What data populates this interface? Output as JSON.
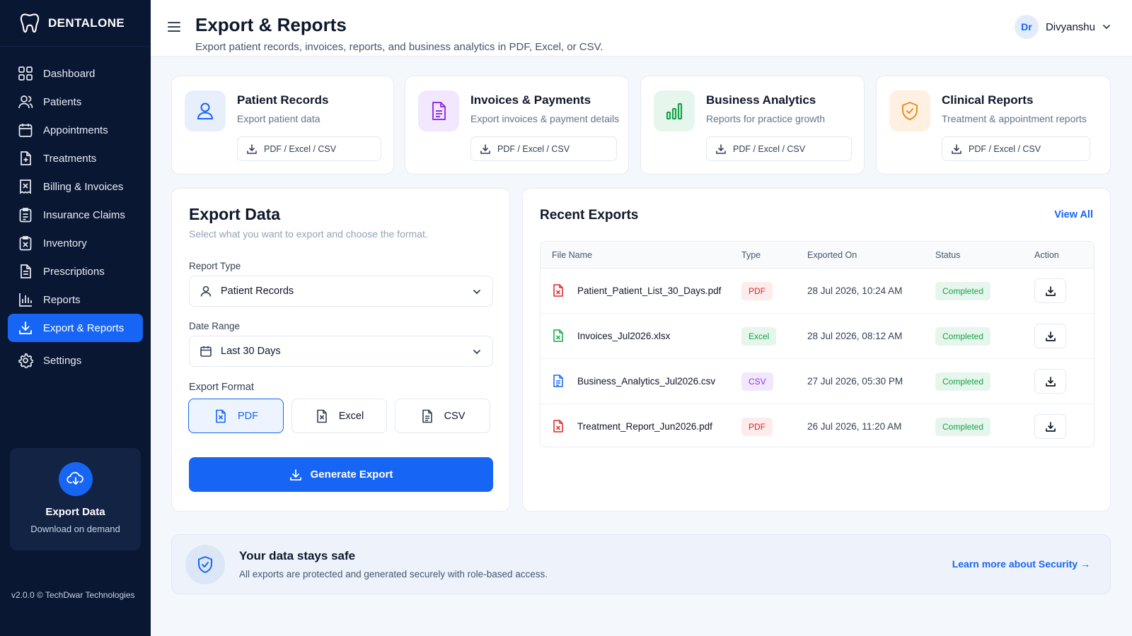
{
  "brand": {
    "name": "DENTALONE"
  },
  "sidebar": {
    "items": [
      {
        "label": "Dashboard",
        "icon": "grid-icon"
      },
      {
        "label": "Patients",
        "icon": "users-icon"
      },
      {
        "label": "Appointments",
        "icon": "calendar-icon"
      },
      {
        "label": "Treatments",
        "icon": "file-plus-icon"
      },
      {
        "label": "Billing & Invoices",
        "icon": "invoice-icon"
      },
      {
        "label": "Insurance Claims",
        "icon": "clipboard-icon"
      },
      {
        "label": "Inventory",
        "icon": "box-icon"
      },
      {
        "label": "Prescriptions",
        "icon": "prescription-icon"
      },
      {
        "label": "Reports",
        "icon": "bar-chart-icon"
      },
      {
        "label": "Export & Reports",
        "icon": "download-icon",
        "active": true
      },
      {
        "label": "Settings",
        "icon": "gear-icon"
      }
    ],
    "promo": {
      "title": "Export Data",
      "subtitle": "Download on demand"
    },
    "version": "v2.0.0 © TechDwar Technologies"
  },
  "header": {
    "title": "Export & Reports",
    "subtitle": "Export patient records, invoices, reports, and business analytics in PDF, Excel, or CSV.",
    "user": {
      "initials": "Dr",
      "name": "Divyanshu"
    }
  },
  "categories": [
    {
      "title": "Patient Records",
      "desc": "Export patient data",
      "button": "PDF / Excel / CSV",
      "icon": "user-icon",
      "color": "#1765f5",
      "bg": "#e7effd"
    },
    {
      "title": "Invoices & Payments",
      "desc": "Export invoices & payment details",
      "button": "PDF / Excel / CSV",
      "icon": "document-icon",
      "color": "#9333ea",
      "bg": "#f1e8fd"
    },
    {
      "title": "Business Analytics",
      "desc": "Reports for practice growth",
      "button": "PDF / Excel / CSV",
      "icon": "bar-chart-icon",
      "color": "#16a34a",
      "bg": "#e6f6ec"
    },
    {
      "title": "Clinical Reports",
      "desc": "Treatment & appointment reports",
      "button": "PDF / Excel / CSV",
      "icon": "shield-icon",
      "color": "#f08c1a",
      "bg": "#fef1e2"
    }
  ],
  "export": {
    "title": "Export Data",
    "subtitle": "Select what you want to export and choose the format.",
    "report_type_label": "Report Type",
    "report_type_value": "Patient Records",
    "date_range_label": "Date Range",
    "date_range_value": "Last 30 Days",
    "format_label": "Export Format",
    "formats": [
      {
        "label": "PDF",
        "selected": true
      },
      {
        "label": "Excel",
        "selected": false
      },
      {
        "label": "CSV",
        "selected": false
      }
    ],
    "generate_label": "Generate Export"
  },
  "recent": {
    "title": "Recent Exports",
    "view_all": "View All",
    "columns": [
      "File Name",
      "Type",
      "Exported On",
      "Status",
      "Action"
    ],
    "rows": [
      {
        "file": "Patient_Patient_List_30_Days.pdf",
        "type": "PDF",
        "date": "28 Jul 2026, 10:24 AM",
        "status": "Completed"
      },
      {
        "file": "Invoices_Jul2026.xlsx",
        "type": "Excel",
        "date": "28 Jul 2026, 08:12 AM",
        "status": "Completed"
      },
      {
        "file": "Business_Analytics_Jul2026.csv",
        "type": "CSV",
        "date": "27 Jul 2026, 05:30 PM",
        "status": "Completed"
      },
      {
        "file": "Treatment_Report_Jun2026.pdf",
        "type": "PDF",
        "date": "26 Jul 2026, 11:20 AM",
        "status": "Completed"
      }
    ]
  },
  "security": {
    "title": "Your data stays safe",
    "subtitle": "All exports are protected and generated securely with role-based access.",
    "link": "Learn more about Security"
  }
}
